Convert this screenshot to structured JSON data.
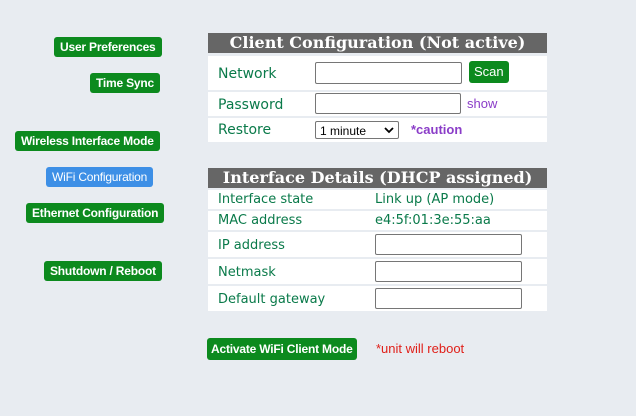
{
  "sidebar": {
    "items": [
      {
        "label": "User Preferences"
      },
      {
        "label": "Time Sync"
      },
      {
        "label": "Wireless Interface Mode"
      },
      {
        "label": "WiFi Configuration"
      },
      {
        "label": "Ethernet Configuration"
      },
      {
        "label": "Shutdown / Reboot"
      }
    ]
  },
  "client_config": {
    "title": "Client Configuration (Not active)",
    "network_label": "Network",
    "network_value": "",
    "scan_label": "Scan",
    "password_label": "Password",
    "password_value": "",
    "show_label": "show",
    "restore_label": "Restore",
    "restore_selected": "1 minute",
    "caution_label": "*caution"
  },
  "interface_details": {
    "title": "Interface Details (DHCP assigned)",
    "state_label": "Interface state",
    "state_value": "Link up (AP mode)",
    "mac_label": "MAC address",
    "mac_value": "e4:5f:01:3e:55:aa",
    "ip_label": "IP address",
    "ip_value": "",
    "netmask_label": "Netmask",
    "netmask_value": "",
    "gateway_label": "Default gateway",
    "gateway_value": ""
  },
  "footer": {
    "activate_label": "Activate WiFi Client Mode",
    "reboot_note": "*unit will reboot"
  },
  "colors": {
    "accent_green": "#0c8a1e",
    "active_blue": "#3d8fe6",
    "header_gray": "#666666",
    "warning_red": "#e0201a"
  }
}
